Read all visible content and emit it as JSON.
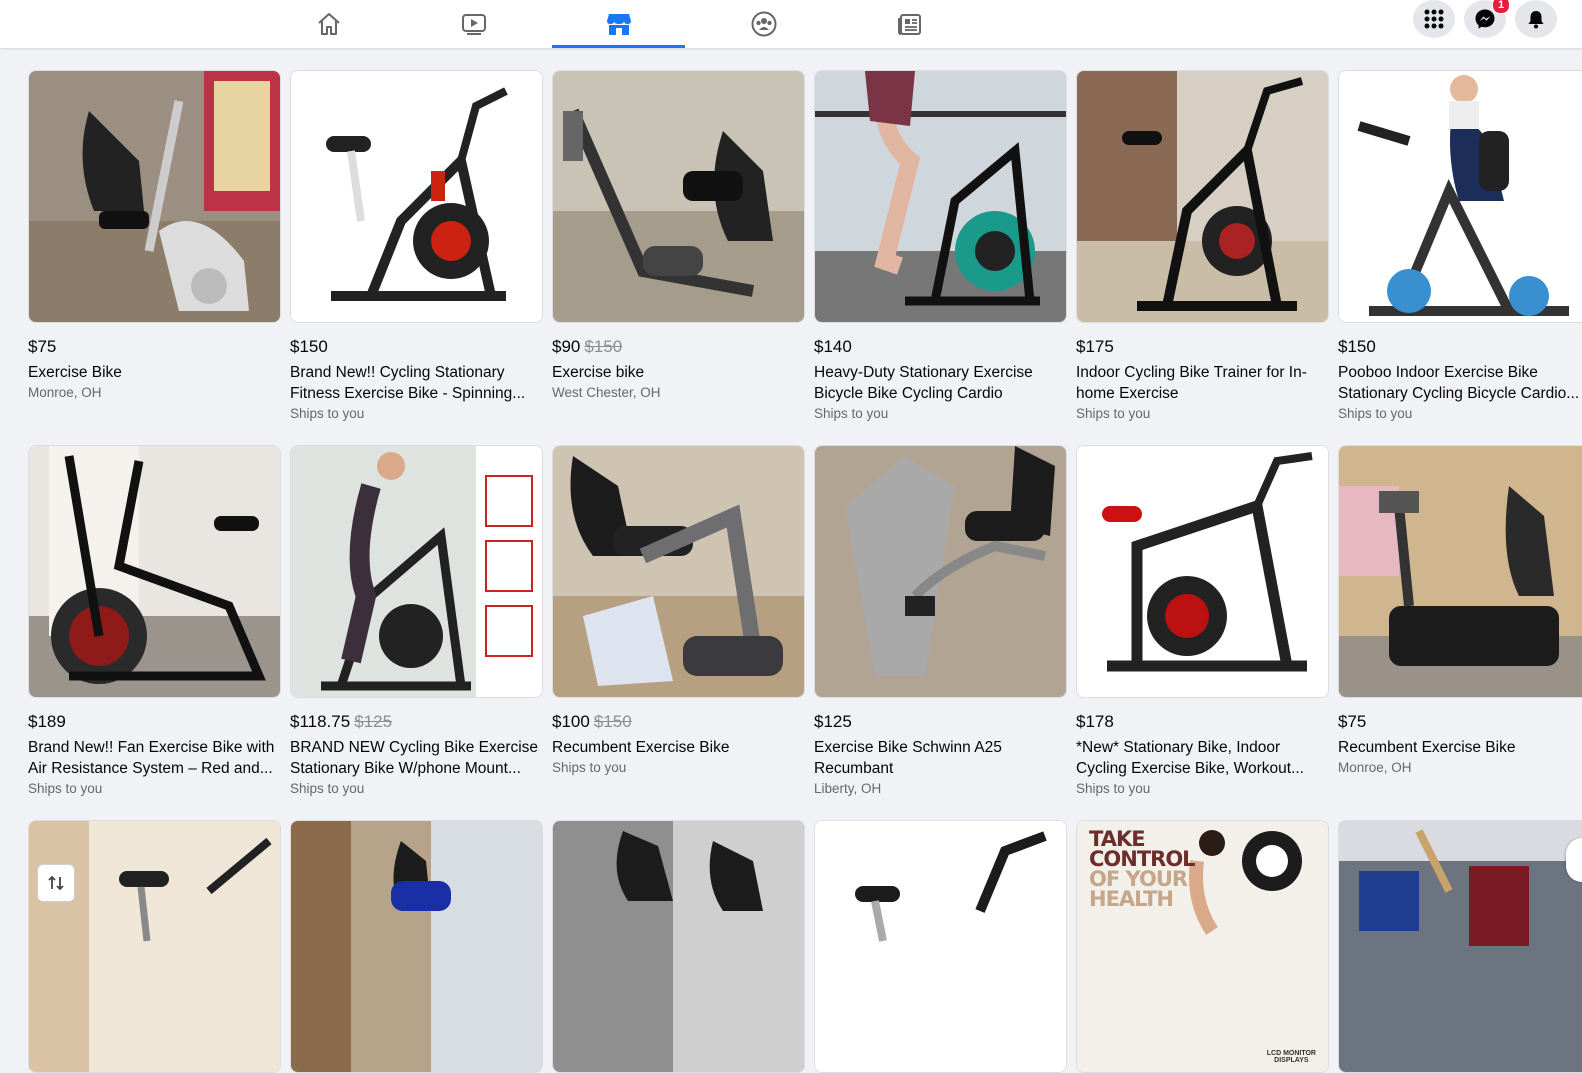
{
  "nav": {
    "tabs": [
      {
        "name": "home",
        "icon": "home-icon"
      },
      {
        "name": "watch",
        "icon": "watch-icon"
      },
      {
        "name": "marketplace",
        "icon": "marketplace-icon",
        "active": true
      },
      {
        "name": "groups",
        "icon": "groups-icon"
      },
      {
        "name": "gaming",
        "icon": "gaming-icon"
      }
    ],
    "messenger_badge": "1",
    "accent": "#1877f2"
  },
  "listings": [
    {
      "price": "$75",
      "original_price": "",
      "title": "Exercise Bike",
      "location": "Monroe, OH"
    },
    {
      "price": "$150",
      "original_price": "",
      "title": "Brand New!! Cycling Stationary Fitness Exercise Bike - Spinning...",
      "location": "Ships to you"
    },
    {
      "price": "$90",
      "original_price": "$150",
      "title": "Exercise bike",
      "location": "West Chester, OH"
    },
    {
      "price": "$140",
      "original_price": "",
      "title": "Heavy-Duty Stationary Exercise Bicycle Bike Cycling Cardio Health...",
      "location": "Ships to you"
    },
    {
      "price": "$175",
      "original_price": "",
      "title": "Indoor Cycling Bike Trainer for In-home Exercise",
      "location": "Ships to you"
    },
    {
      "price": "$150",
      "original_price": "",
      "title": "Pooboo Indoor Exercise Bike Stationary Cycling Bicycle Cardio...",
      "location": "Ships to you"
    },
    {
      "price": "$189",
      "original_price": "",
      "title": "Brand New!! Fan Exercise Bike with Air Resistance System – Red and...",
      "location": "Ships to you"
    },
    {
      "price": "$118.75",
      "original_price": "$125",
      "title": "BRAND NEW Cycling Bike Exercise Stationary Bike W/phone Mount...",
      "location": "Ships to you"
    },
    {
      "price": "$100",
      "original_price": "$150",
      "title": "Recumbent Exercise Bike",
      "location": "Ships to you"
    },
    {
      "price": "$125",
      "original_price": "",
      "title": "Exercise Bike Schwinn A25 Recumbant",
      "location": "Liberty, OH"
    },
    {
      "price": "$178",
      "original_price": "",
      "title": "*New* Stationary Bike, Indoor Cycling Exercise Bike, Workout...",
      "location": "Ships to you"
    },
    {
      "price": "$75",
      "original_price": "",
      "title": "Recumbent Exercise Bike",
      "location": "Monroe, OH"
    }
  ],
  "ad": {
    "line1": "TAKE",
    "line2": "CONTROL",
    "line3": "OF YOUR",
    "line4": "HEALTH",
    "small_line1": "LCD MONITOR",
    "small_line2": "DISPLAYS"
  }
}
